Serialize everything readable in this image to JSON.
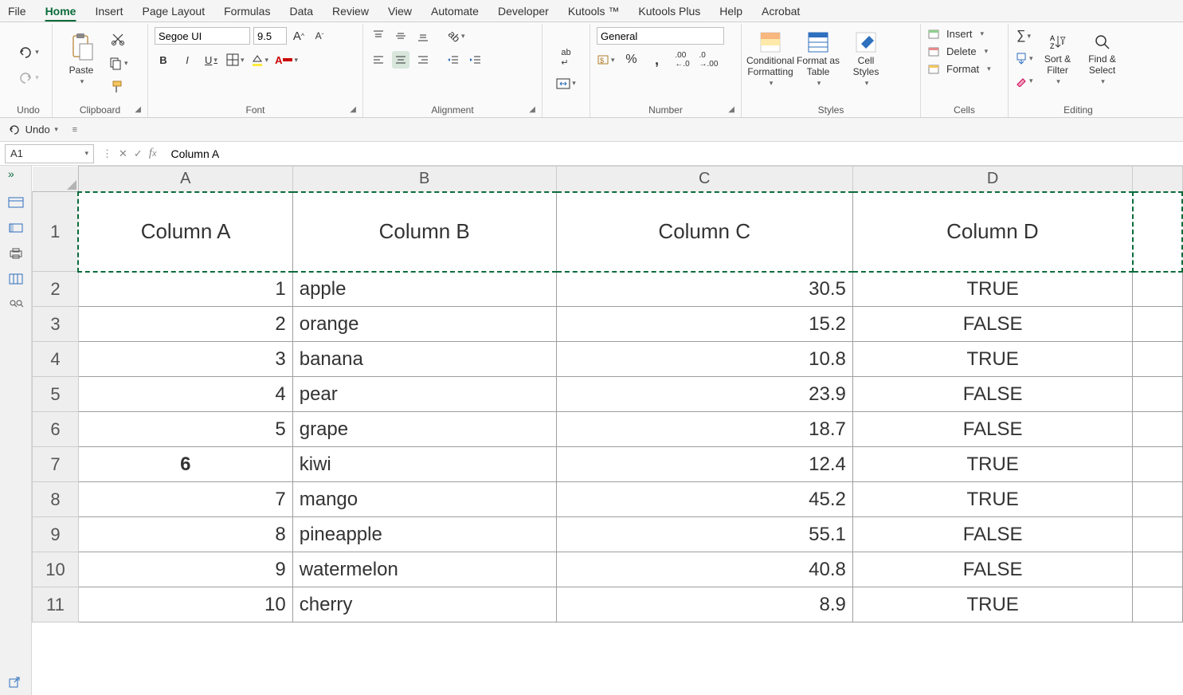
{
  "tabs": {
    "items": [
      "File",
      "Home",
      "Insert",
      "Page Layout",
      "Formulas",
      "Data",
      "Review",
      "View",
      "Automate",
      "Developer",
      "Kutools ™",
      "Kutools Plus",
      "Help",
      "Acrobat"
    ],
    "active_index": 1
  },
  "ribbon": {
    "undo_label": "Undo",
    "clipboard": {
      "paste": "Paste",
      "label": "Clipboard"
    },
    "font": {
      "name": "Segoe UI",
      "size": "9.5",
      "label": "Font"
    },
    "alignment": {
      "label": "Alignment"
    },
    "number": {
      "format": "General",
      "label": "Number"
    },
    "styles": {
      "cond": "Conditional Formatting",
      "table": "Format as Table",
      "cell": "Cell Styles",
      "label": "Styles"
    },
    "cells": {
      "insert": "Insert",
      "delete": "Delete",
      "format": "Format",
      "label": "Cells"
    },
    "editing": {
      "sort": "Sort & Filter",
      "find": "Find & Select",
      "label": "Editing"
    }
  },
  "quickbar": {
    "undo": "Undo"
  },
  "formula_bar": {
    "cell_ref": "A1",
    "formula": "Column A"
  },
  "grid": {
    "col_letters": [
      "A",
      "B",
      "C",
      "D"
    ],
    "row_numbers": [
      "1",
      "2",
      "3",
      "4",
      "5",
      "6",
      "7",
      "8",
      "9",
      "10",
      "11"
    ],
    "headers": [
      "Column A",
      "Column B",
      "Column C",
      "Column D"
    ],
    "rows": [
      {
        "a": "1",
        "b": "apple",
        "c": "30.5",
        "d": "TRUE",
        "bold": false
      },
      {
        "a": "2",
        "b": "orange",
        "c": "15.2",
        "d": "FALSE",
        "bold": false
      },
      {
        "a": "3",
        "b": "banana",
        "c": "10.8",
        "d": "TRUE",
        "bold": false
      },
      {
        "a": "4",
        "b": "pear",
        "c": "23.9",
        "d": "FALSE",
        "bold": false
      },
      {
        "a": "5",
        "b": "grape",
        "c": "18.7",
        "d": "FALSE",
        "bold": false
      },
      {
        "a": "6",
        "b": "kiwi",
        "c": "12.4",
        "d": "TRUE",
        "bold": true
      },
      {
        "a": "7",
        "b": "mango",
        "c": "45.2",
        "d": "TRUE",
        "bold": false
      },
      {
        "a": "8",
        "b": "pineapple",
        "c": "55.1",
        "d": "FALSE",
        "bold": false
      },
      {
        "a": "9",
        "b": "watermelon",
        "c": "40.8",
        "d": "FALSE",
        "bold": false
      },
      {
        "a": "10",
        "b": "cherry",
        "c": "8.9",
        "d": "TRUE",
        "bold": false
      }
    ]
  },
  "colors": {
    "accent": "#0b6b3a"
  }
}
